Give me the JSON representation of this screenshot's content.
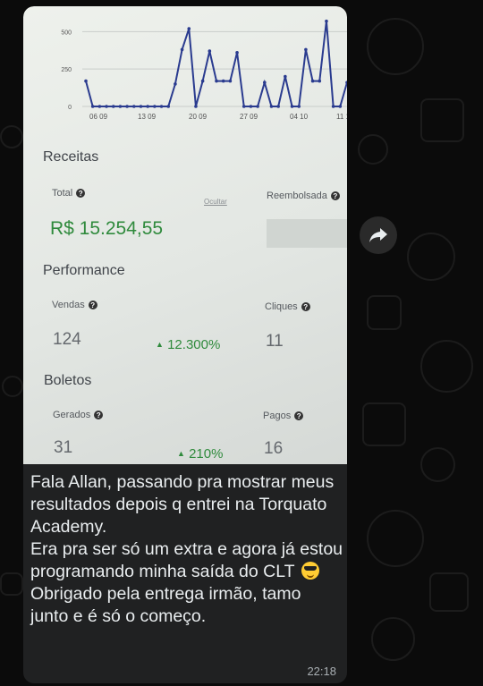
{
  "screenshot": {
    "chart_data": {
      "type": "line",
      "x_tick_labels": [
        "06 09",
        "13 09",
        "20 09",
        "27 09",
        "04 10",
        "11 1"
      ],
      "y_tick_labels": [
        "500",
        "250",
        "0"
      ],
      "ylim": [
        0,
        550
      ],
      "grid": true,
      "series": [
        {
          "color": "#2a3b8f",
          "values": [
            170,
            0,
            0,
            0,
            0,
            0,
            0,
            0,
            0,
            0,
            0,
            0,
            0,
            150,
            380,
            520,
            0,
            170,
            370,
            170,
            170,
            170,
            360,
            0,
            0,
            0,
            160,
            0,
            0,
            200,
            0,
            0,
            380,
            170,
            170,
            570,
            0,
            0,
            160
          ]
        }
      ]
    },
    "receitas": {
      "title": "Receitas",
      "total_label": "Total",
      "hide_label": "Ocultar",
      "total_value": "R$ 15.254,55",
      "refunded_label": "Reembolsada"
    },
    "performance": {
      "title": "Performance",
      "sales_label": "Vendas",
      "sales_value": "124",
      "sales_change": "12.300%",
      "clicks_label": "Cliques",
      "clicks_value": "11"
    },
    "boletos": {
      "title": "Boletos",
      "generated_label": "Gerados",
      "generated_value": "31",
      "generated_change": "210%",
      "paid_label": "Pagos",
      "paid_value": "16"
    }
  },
  "message": {
    "lines": [
      "Fala Allan, passando pra mostrar meus resultados depois q entrei na Torquato Academy.",
      "Era pra ser só um extra e agora já estou programando minha saída do CLT",
      "Obrigado pela entrega irmão, tamo junto e é só o começo."
    ],
    "time": "22:18"
  },
  "colors": {
    "chat_background": "#0b0b0b",
    "bubble": "#202122",
    "message_text": "#e9edef",
    "positive_change": "#2f8a3c"
  },
  "icons": {
    "forward": "forward-arrow-icon",
    "emoji": "sunglasses-emoji-icon",
    "help": "question-icon",
    "up": "triangle-up-icon"
  }
}
